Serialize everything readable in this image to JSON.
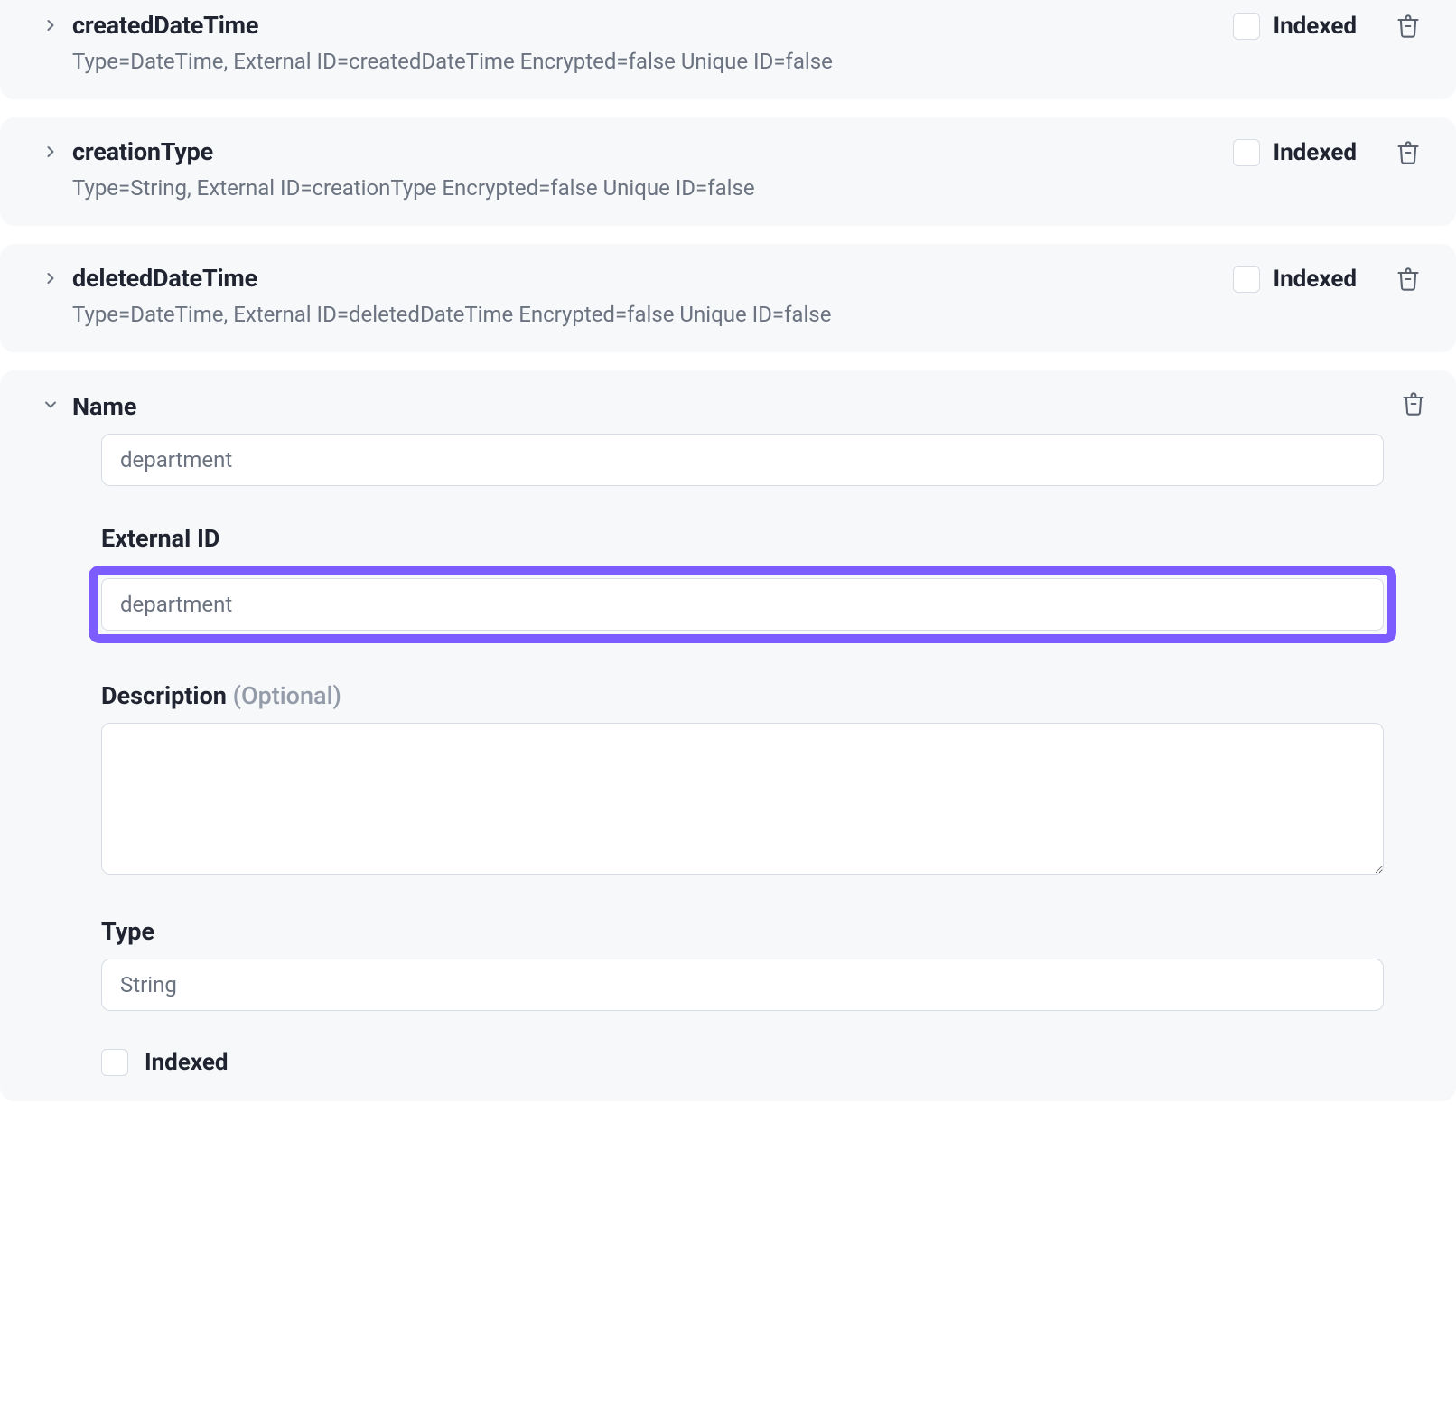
{
  "indexed_label": "Indexed",
  "fields": [
    {
      "name": "createdDateTime",
      "summary": "Type=DateTime, External ID=createdDateTime Encrypted=false Unique ID=false"
    },
    {
      "name": "creationType",
      "summary": "Type=String, External ID=creationType Encrypted=false Unique ID=false"
    },
    {
      "name": "deletedDateTime",
      "summary": "Type=DateTime, External ID=deletedDateTime Encrypted=false Unique ID=false"
    }
  ],
  "expanded": {
    "name_label": "Name",
    "name_value": "department",
    "external_id_label": "External ID",
    "external_id_value": "department",
    "description_label": "Description",
    "description_optional": "(Optional)",
    "description_value": "",
    "type_label": "Type",
    "type_value": "String",
    "indexed_label": "Indexed"
  }
}
